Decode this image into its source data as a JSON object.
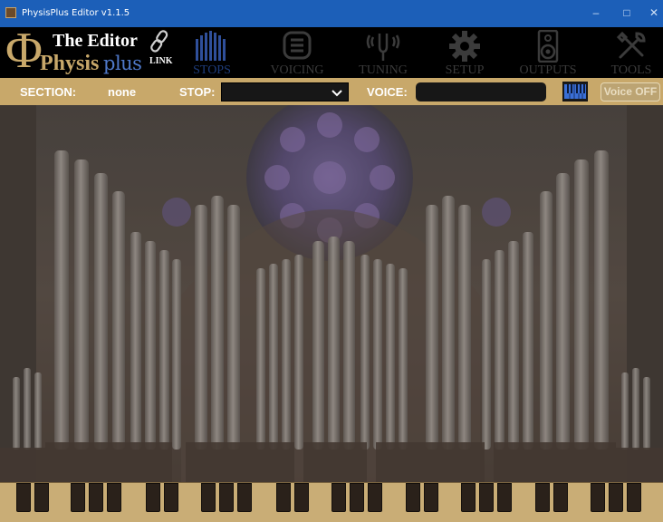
{
  "window": {
    "title": "PhysisPlus Editor v1.1.5",
    "controls": [
      "–",
      "□",
      "✕"
    ]
  },
  "brand": {
    "line1": "The Editor",
    "line2": "Physis",
    "plus": "plus",
    "link_label": "LINK"
  },
  "toolbar": {
    "items": [
      {
        "label": "STOPS",
        "icon": "organ-pipes-icon",
        "active": true
      },
      {
        "label": "VOICING",
        "icon": "voicing-icon",
        "active": false
      },
      {
        "label": "TUNING",
        "icon": "tuning-fork-icon",
        "active": false
      },
      {
        "label": "SETUP",
        "icon": "gear-icon",
        "active": false
      },
      {
        "label": "OUTPUTS",
        "icon": "speaker-icon",
        "active": false
      },
      {
        "label": "TOOLS",
        "icon": "tools-icon",
        "active": false
      }
    ]
  },
  "sectionbar": {
    "section_label": "SECTION:",
    "section_value": "none",
    "stop_label": "STOP:",
    "stop_value": "",
    "voice_label": "VOICE:",
    "voice_value": "",
    "voice_toggle": "Voice OFF"
  },
  "colors": {
    "titlebar": "#1c5fb8",
    "gold": "#c8a86a",
    "accent_blue": "#2f5fbf"
  }
}
